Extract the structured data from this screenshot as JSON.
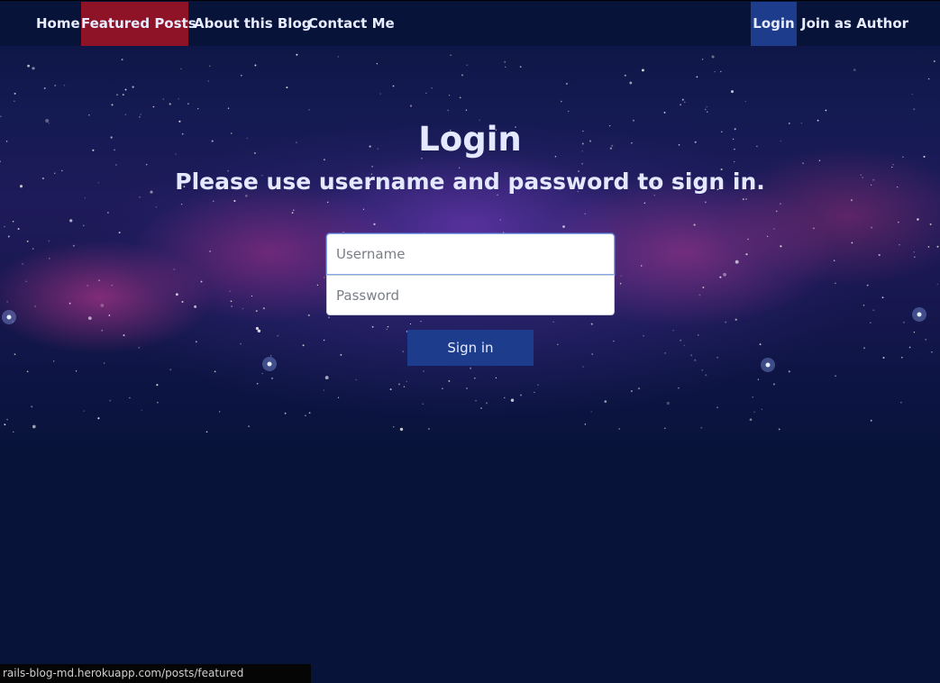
{
  "nav": {
    "left": [
      {
        "label": "Home"
      },
      {
        "label": "Featured Posts"
      },
      {
        "label": "About this Blog"
      },
      {
        "label": "Contact Me"
      }
    ],
    "right": [
      {
        "label": "Login"
      },
      {
        "label": "Join as Author"
      }
    ]
  },
  "login": {
    "title": "Login",
    "subtitle": "Please use username and password to sign in.",
    "username_placeholder": "Username",
    "username_value": "",
    "password_placeholder": "Password",
    "password_value": "",
    "submit_label": "Sign in"
  },
  "statusbar": {
    "url": "rails-blog-md.herokuapp.com/posts/featured"
  },
  "colors": {
    "page_background": "#08133a",
    "featured_highlight": "#8e1326",
    "login_highlight": "#1e3c8c",
    "button_background": "#1e3c8c",
    "text": "#e8ecff"
  }
}
